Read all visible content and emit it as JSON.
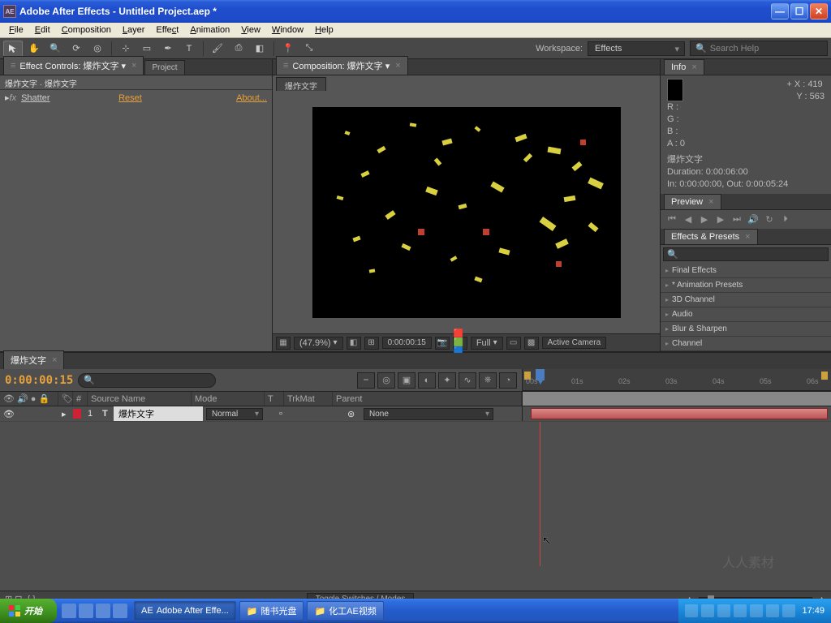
{
  "titlebar": {
    "app_icon": "AE",
    "title": "Adobe After Effects - Untitled Project.aep *"
  },
  "menu": {
    "file": "File",
    "edit": "Edit",
    "composition": "Composition",
    "layer": "Layer",
    "effect": "Effect",
    "animation": "Animation",
    "view": "View",
    "window": "Window",
    "help": "Help"
  },
  "toolbar": {
    "workspace_label": "Workspace:",
    "workspace_value": "Effects",
    "search_placeholder": "Search Help"
  },
  "effect_controls": {
    "tab1": "Effect Controls: 爆炸文字",
    "tab2": "Project",
    "subtitle": "爆炸文字 · 爆炸文字",
    "effect_name": "Shatter",
    "reset": "Reset",
    "about": "About..."
  },
  "composition": {
    "tab": "Composition: 爆炸文字",
    "subtab": "爆炸文字",
    "footer": {
      "zoom": "(47.9%)",
      "res_half": "",
      "time": "0:00:00:15",
      "quality": "Full",
      "camera": "Active Camera"
    }
  },
  "info": {
    "tab": "Info",
    "r": "R :",
    "g": "G :",
    "b": "B :",
    "a": "A : 0",
    "x": "X : 419",
    "y": "Y : 563",
    "layer": "爆炸文字",
    "duration": "Duration: 0:00:06:00",
    "inout": "In: 0:00:00:00, Out: 0:00:05:24"
  },
  "preview": {
    "tab": "Preview"
  },
  "effects_presets": {
    "tab": "Effects & Presets",
    "items": [
      "Final Effects",
      "* Animation Presets",
      "3D Channel",
      "Audio",
      "Blur & Sharpen",
      "Channel"
    ]
  },
  "timeline": {
    "tab": "爆炸文字",
    "timecode": "0:00:00:15",
    "cols": {
      "source": "Source Name",
      "mode": "Mode",
      "t": "T",
      "trkmat": "TrkMat",
      "parent": "Parent"
    },
    "layer1": {
      "num": "1",
      "type": "T",
      "name": "爆炸文字",
      "mode": "Normal",
      "parent": "None"
    },
    "ruler": [
      "00s",
      "01s",
      "02s",
      "03s",
      "04s",
      "05s",
      "06s"
    ],
    "toggle": "Toggle Switches / Modes"
  },
  "taskbar": {
    "start": "开始",
    "tasks": [
      {
        "icon": "AE",
        "label": "Adobe After Effe..."
      },
      {
        "icon": "📁",
        "label": "随书光盘"
      },
      {
        "icon": "📁",
        "label": "化工AE视频"
      }
    ],
    "clock": "17:49"
  },
  "watermark": "人人素材"
}
